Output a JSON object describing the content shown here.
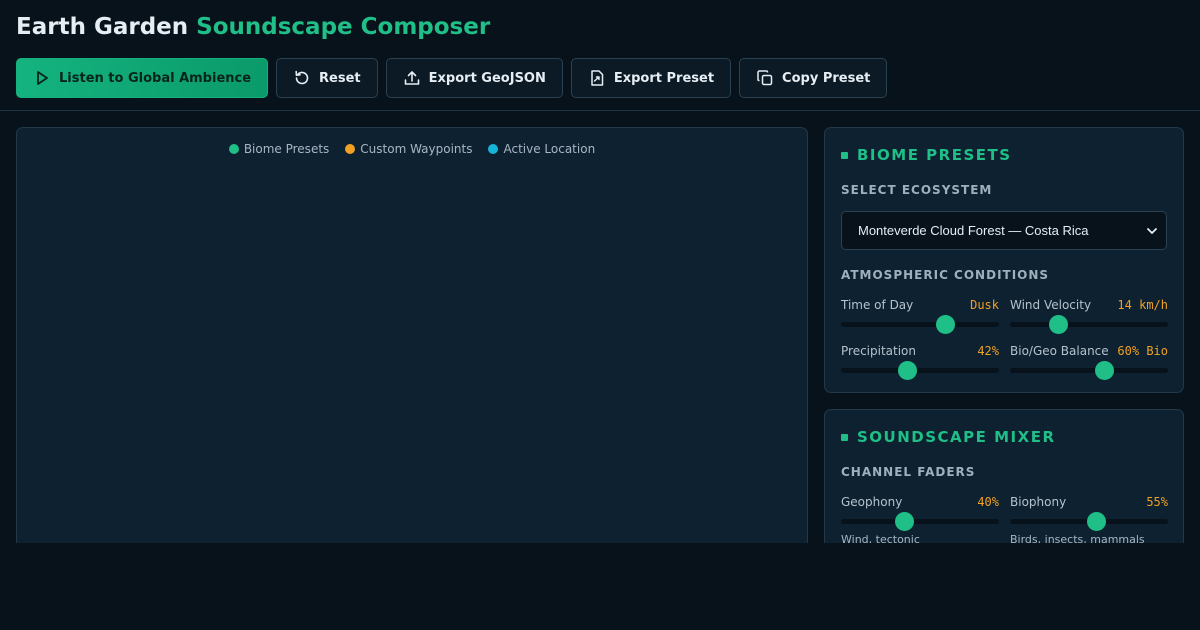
{
  "app": {
    "title_main": "Earth Garden",
    "title_accent": "Soundscape Composer"
  },
  "toolbar": {
    "listen_label": "Listen to Global Ambience",
    "reset_label": "Reset",
    "export_geojson_label": "Export GeoJSON",
    "export_preset_label": "Export Preset",
    "copy_preset_label": "Copy Preset"
  },
  "map": {
    "legend": [
      {
        "label": "Biome Presets",
        "color": "#1fbf87"
      },
      {
        "label": "Custom Waypoints",
        "color": "#f0a124"
      },
      {
        "label": "Active Location",
        "color": "#16b4d8"
      }
    ]
  },
  "biome": {
    "title": "BIOME PRESETS",
    "select_label": "SELECT ECOSYSTEM",
    "selected": "Monteverde Cloud Forest — Costa Rica",
    "conditions_label": "ATMOSPHERIC CONDITIONS",
    "controls": [
      {
        "label": "Time of Day",
        "value": "Dusk",
        "level": 0.66
      },
      {
        "label": "Wind Velocity",
        "value": "14 km/h",
        "level": 0.31
      },
      {
        "label": "Precipitation",
        "value": "42%",
        "level": 0.42
      },
      {
        "label": "Bio/Geo Balance",
        "value": "60% Bio",
        "level": 0.6
      }
    ]
  },
  "mixer": {
    "title": "SOUNDSCAPE MIXER",
    "faders_label": "CHANNEL FADERS",
    "channels": [
      {
        "label": "Geophony",
        "value": "40%",
        "level": 0.4,
        "hint": "Wind, tectonic"
      },
      {
        "label": "Biophony",
        "value": "55%",
        "level": 0.55,
        "hint": "Birds, insects, mammals"
      }
    ]
  },
  "colors": {
    "accent": "#1fbf87",
    "value": "#f0a124",
    "background": "#07121b",
    "panel": "#0e2131"
  }
}
